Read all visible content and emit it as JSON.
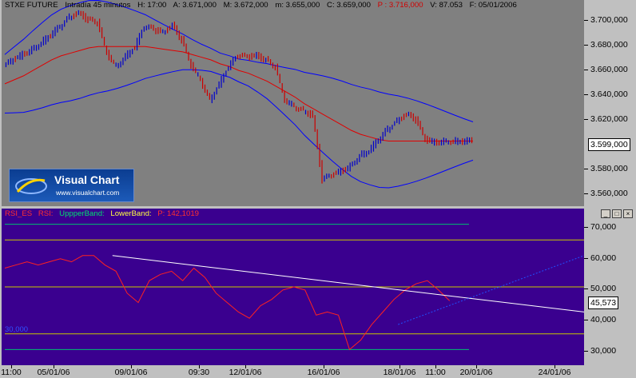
{
  "header": {
    "symbol": "STXE FUTURE",
    "interval": "Intradía 45 minutos",
    "high": "H: 17:00",
    "open": "A: 3.671,000",
    "max": "M: 3.672,000",
    "min": "m: 3.655,000",
    "close": "C: 3.659,000",
    "p_value": "P : 3.716,000",
    "volume": "V: 87.053",
    "date": "F: 05/01/2006"
  },
  "price_axis": {
    "labels": [
      "3.700,000",
      "3.680,000",
      "3.660,000",
      "3.640,000",
      "3.620,000",
      "3.580,000",
      "3.560,000"
    ],
    "current": "3.599,000"
  },
  "rsi_header": {
    "name": "RSI_ES",
    "rsi_label": "RSI:",
    "upper_label": "UppperBand:",
    "lower_label": "LowerBand:",
    "p_label": "P: 142,1019"
  },
  "rsi_axis": {
    "labels": [
      "70,000",
      "60,000",
      "50,000",
      "40,000",
      "30,000"
    ],
    "current": "45,573",
    "left_marker": "30,000"
  },
  "x_axis": {
    "labels": [
      "11:00",
      "05/01/06",
      "09/01/06",
      "09:30",
      "12/01/06",
      "16/01/06",
      "18/01/06",
      "11:00",
      "20/01/06",
      "24/01/06"
    ]
  },
  "window_buttons": [
    "_",
    "□",
    "×"
  ],
  "logo": {
    "brand": "Visual Chart",
    "url": "www.visualchart.com"
  },
  "colors": {
    "price_bg": "#808080",
    "rsi_bg": "#3a008f",
    "bull_bar": "#0000cc",
    "bear_bar": "#cc0000",
    "bollinger_upper": "#0000ff",
    "moving_avg": "#e00000",
    "rsi_line": "#ff2020",
    "band_line": "#c8c800",
    "outer_band": "#00c070",
    "trendline": "#ffffff",
    "trend_dotted": "#2050ff"
  },
  "chart_data": [
    {
      "type": "line",
      "ylim": [
        3550,
        3705
      ],
      "x": [
        0,
        2,
        4,
        6,
        8,
        10,
        12,
        14,
        16,
        18,
        20,
        22,
        24,
        26,
        28,
        30,
        32,
        34,
        36,
        38,
        40,
        42,
        44,
        46,
        48,
        50,
        52,
        54,
        56,
        58,
        60,
        62,
        64,
        66,
        68,
        70,
        72,
        74,
        76,
        78,
        80,
        82,
        84,
        86,
        88,
        90,
        92,
        94,
        96,
        98,
        100
      ],
      "series": [
        {
          "values": [
            3655,
            3660,
            3664,
            3668,
            3673,
            3679,
            3685,
            3692,
            3695,
            3690,
            3688,
            3665,
            3655,
            3663,
            3670,
            3685,
            3683,
            3680,
            3686,
            3675,
            3656,
            3645,
            3630,
            3642,
            3655,
            3663,
            3662,
            3663,
            3660,
            3655,
            3630,
            3625,
            3622,
            3618,
            3570,
            3573,
            3576,
            3580,
            3588,
            3592,
            3600,
            3608,
            3614,
            3619,
            3615,
            3600,
            3598,
            3599,
            3599,
            3599,
            3599
          ]
        },
        {
          "values": [
            3642,
            3645,
            3648,
            3652,
            3656,
            3660,
            3663,
            3665,
            3667,
            3669,
            3670,
            3670,
            3670,
            3670,
            3670,
            3670,
            3669,
            3668,
            3667,
            3666,
            3664,
            3662,
            3660,
            3657,
            3655,
            3652,
            3650,
            3647,
            3644,
            3640,
            3636,
            3632,
            3627,
            3623,
            3619,
            3615,
            3611,
            3607,
            3604,
            3602,
            3600,
            3599,
            3599,
            3599,
            3599,
            3599,
            3599,
            3599,
            3599,
            3599,
            3599
          ]
        }
      ]
    },
    {
      "type": "line",
      "ylim": [
        25,
        75
      ],
      "x": [
        0,
        2,
        4,
        6,
        8,
        10,
        12,
        14,
        16,
        18,
        20,
        22,
        24,
        26,
        28,
        30,
        32,
        34,
        36,
        38,
        40,
        42,
        44,
        46,
        48,
        50,
        52,
        54,
        56,
        58,
        60,
        62,
        64,
        66,
        68,
        70,
        72,
        74,
        76,
        78,
        80
      ],
      "series": [
        {
          "values": [
            56,
            57,
            58,
            57,
            58,
            59,
            58,
            60,
            60,
            57,
            55,
            48,
            45,
            52,
            54,
            55,
            52,
            56,
            53,
            48,
            45,
            42,
            40,
            44,
            46,
            49,
            50,
            49,
            41,
            42,
            41,
            30,
            33,
            38,
            42,
            46,
            49,
            51,
            52,
            49,
            45.573
          ]
        }
      ]
    }
  ]
}
